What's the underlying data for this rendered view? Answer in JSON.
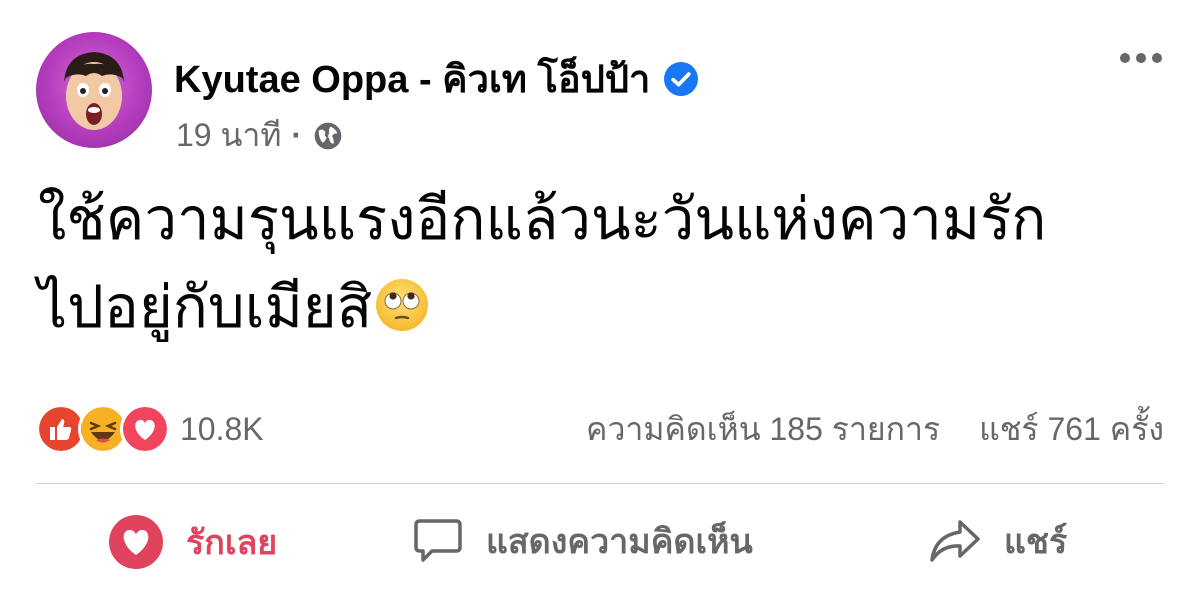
{
  "post": {
    "author": "Kyutae Oppa - คิวเท โอ็ปป้า",
    "time": "19 นาที",
    "separator": "·",
    "text_line1": "ใช้ความรุนแรงอีกแล้วนะวันแห่งความรัก",
    "text_line2": "ไปอยู่กับเมียสิ",
    "emoji_name": "face-with-rolling-eyes"
  },
  "reactions": {
    "icons": [
      "like",
      "haha",
      "love"
    ],
    "count": "10.8K",
    "comments": "ความคิดเห็น 185 รายการ",
    "shares": "แชร์ 761 ครั้ง"
  },
  "actions": {
    "love_label": "รักเลย",
    "comment_label": "แสดงความคิดเห็น",
    "share_label": "แชร์"
  },
  "colors": {
    "verified": "#1877f2",
    "love": "#e0435d",
    "secondary_text": "#65676b",
    "like": "#1877f2",
    "haha": "#f7b125"
  }
}
